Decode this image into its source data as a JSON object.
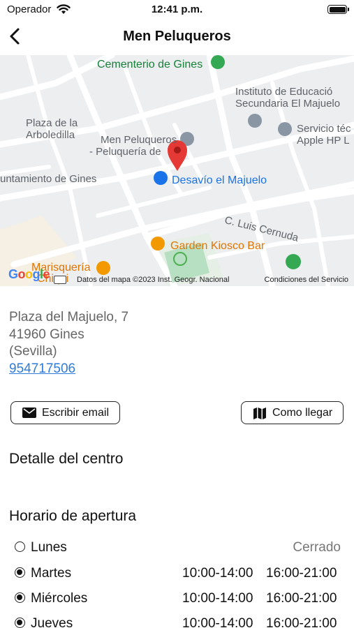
{
  "status_bar": {
    "carrier": "Operador",
    "time": "12:41 p.m."
  },
  "nav": {
    "title": "Men Peluqueros"
  },
  "map": {
    "labels": {
      "cementerio": "Cementerio de Gines",
      "instituto_1": "Instituto de Educació",
      "instituto_2": "Secundaria El Majuelo",
      "plaza_1": "Plaza de la",
      "plaza_2": "Arboledilla",
      "men_1": "Men Peluqueros",
      "men_2": "- Peluquería de",
      "servicio_1": "Servicio téc",
      "servicio_2": "Apple HP L",
      "ayuntamiento": "untamiento de Gines",
      "desavio": "Desavío el Majuelo",
      "cernuda": "C. Luis Cernuda",
      "garden": "Garden Kiosco Bar",
      "marisqueria_1": "Marisquería",
      "marisqueria_2": "Chiqui"
    },
    "google_logo": "Google",
    "data_credit": "Datos del mapa ©2023 Inst. Geogr. Nacional",
    "terms": "Condiciones del Servicio",
    "colors": {
      "pin": "#e53935",
      "park": "#188038",
      "shop": "#1a73e8",
      "food": "#e37400"
    }
  },
  "address": {
    "line1": "Plaza del Majuelo, 7",
    "line2": "41960 Gines",
    "line3": "(Sevilla)",
    "phone": "954717506"
  },
  "buttons": {
    "email": "Escribir email",
    "email_icon": "envelope-icon",
    "route": "Como llegar",
    "route_icon": "map-icon"
  },
  "sections": {
    "detail": "Detalle del centro",
    "hours": "Horario de apertura"
  },
  "hours": [
    {
      "day": "Lunes",
      "status": "Cerrado",
      "open": false,
      "morning": "",
      "afternoon": ""
    },
    {
      "day": "Martes",
      "status": "",
      "open": true,
      "morning": "10:00-14:00",
      "afternoon": "16:00-21:00"
    },
    {
      "day": "Miércoles",
      "status": "",
      "open": true,
      "morning": "10:00-14:00",
      "afternoon": "16:00-21:00"
    },
    {
      "day": "Jueves",
      "status": "",
      "open": true,
      "morning": "10:00-14:00",
      "afternoon": "16:00-21:00"
    }
  ]
}
